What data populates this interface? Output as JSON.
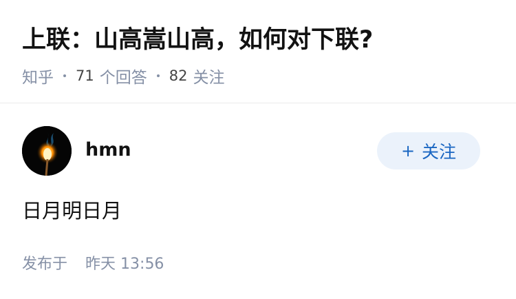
{
  "question": {
    "title": "上联：山高嵩山高，如何对下联?",
    "source": "知乎",
    "answer_count": "71",
    "answer_label": "个回答",
    "follower_count": "82",
    "follower_label": "关注"
  },
  "answer": {
    "author": {
      "name": "hmn",
      "avatar_icon": "match-flame-avatar"
    },
    "follow_button": {
      "icon": "+",
      "label": "关注"
    },
    "content": "日月明日月",
    "publish_label": "发布于",
    "publish_day": "昨天",
    "publish_clock": "13:56"
  },
  "colors": {
    "title": "#121212",
    "meta": "#8590a6",
    "accent": "#1a66c2",
    "follow_bg": "#ebf2fb"
  }
}
